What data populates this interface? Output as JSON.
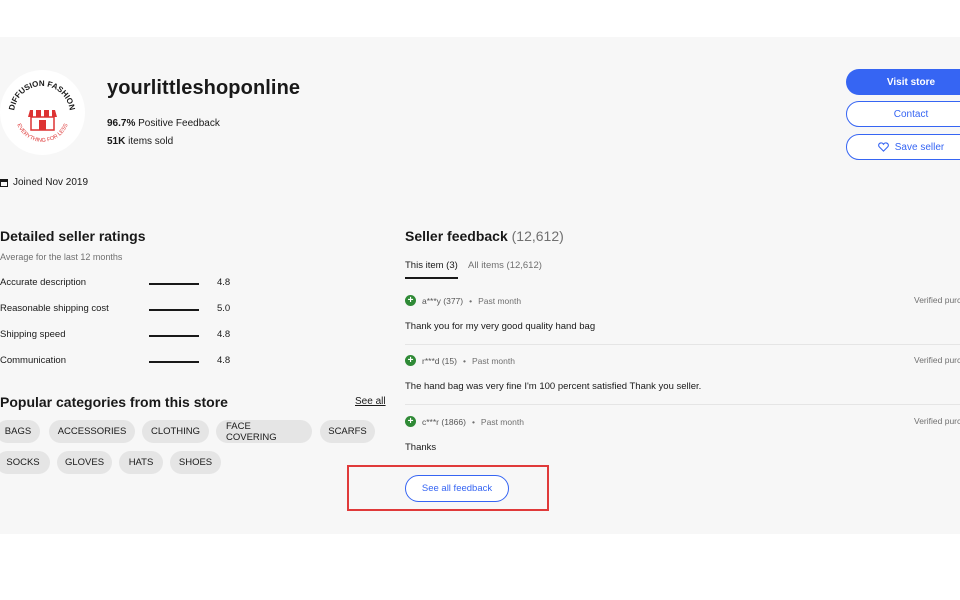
{
  "shop": {
    "name": "yourlittleshoponline",
    "positive_feedback_pct": "96.7%",
    "positive_feedback_label": "Positive Feedback",
    "items_sold": "51K",
    "items_sold_label": "items sold",
    "joined": "Joined Nov 2019",
    "logo_text_top": "DIFFUSION FASHION",
    "logo_text_bottom": "EVERYTHING FOR LESS"
  },
  "actions": {
    "visit_store": "Visit store",
    "contact": "Contact",
    "save_seller": "Save seller"
  },
  "ratings": {
    "title": "Detailed seller ratings",
    "subtitle": "Average for the last 12 months",
    "items": [
      {
        "label": "Accurate description",
        "value": "4.8"
      },
      {
        "label": "Reasonable shipping cost",
        "value": "5.0"
      },
      {
        "label": "Shipping speed",
        "value": "4.8"
      },
      {
        "label": "Communication",
        "value": "4.8"
      }
    ]
  },
  "categories": {
    "title": "Popular categories from this store",
    "see_all": "See all",
    "items": [
      "BAGS",
      "ACCESSORIES",
      "CLOTHING",
      "FACE COVERING",
      "SCARFS",
      "SOCKS",
      "GLOVES",
      "HATS",
      "SHOES"
    ]
  },
  "feedback": {
    "title": "Seller feedback",
    "count": "(12,612)",
    "tabs": [
      "This item (3)",
      "All items (12,612)"
    ],
    "items": [
      {
        "user": "a***y (377)",
        "time": "Past month",
        "verified": "Verified purchase",
        "text": "Thank you for my very good quality hand bag"
      },
      {
        "user": "r***d (15)",
        "time": "Past month",
        "verified": "Verified purchase",
        "text": "The hand bag was very fine I'm 100 percent satisfied Thank you seller."
      },
      {
        "user": "c***r (1866)",
        "time": "Past month",
        "verified": "Verified purchase",
        "text": "Thanks"
      }
    ],
    "see_all_feedback": "See all feedback"
  },
  "colors": {
    "accent": "#3665f3",
    "positive": "#2f8a36",
    "highlight": "#e03a3a",
    "chip_bg": "#e5e5e5",
    "panel_bg": "#f7f7f7"
  }
}
